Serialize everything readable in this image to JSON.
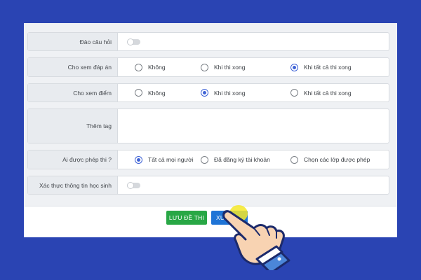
{
  "form": {
    "shuffle": {
      "label": "Đảo câu hỏi",
      "enabled": false
    },
    "show_answers": {
      "label": "Cho xem đáp án",
      "options": [
        "Không",
        "Khi thi xong",
        "Khi tất cả thi xong"
      ],
      "selected": "Khi tất cả thi xong"
    },
    "show_score": {
      "label": "Cho xem điểm",
      "options": [
        "Không",
        "Khi thi xong",
        "Khi tất cả thi xong"
      ],
      "selected": "Khi thi xong"
    },
    "tags": {
      "label": "Thêm tag",
      "value": ""
    },
    "who_can_take": {
      "label": "Ai được phép thi ?",
      "options": [
        "Tất cả mọi người",
        "Đã đăng ký tài khoản",
        "Chọn các lớp được phép"
      ],
      "selected": "Tất cả mọi người"
    },
    "verify_student": {
      "label": "Xác thực thông tin học sinh",
      "enabled": false
    }
  },
  "buttons": {
    "save_label": "LƯU ĐỀ THI",
    "publish_label_visible": "XUẤ"
  },
  "colors": {
    "background": "#2a44b3",
    "save_button": "#28a745",
    "publish_button": "#1f74d6",
    "radio_accent": "#3f63d6",
    "click_highlight": "#f5e828"
  }
}
